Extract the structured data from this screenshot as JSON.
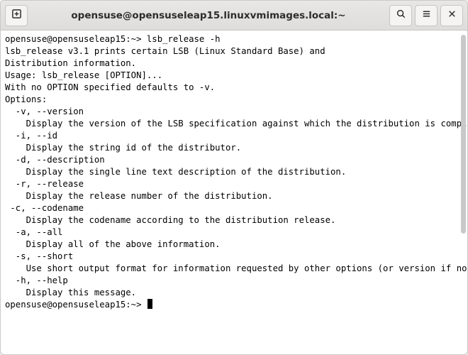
{
  "titlebar": {
    "title": "opensuse@opensuseleap15.linuxvmimages.local:~",
    "new_tab_icon": "new-tab-icon",
    "search_icon": "search-icon",
    "menu_icon": "hamburger-menu-icon",
    "close_icon": "close-icon"
  },
  "terminal": {
    "prompt1": "opensuse@opensuseleap15:~> ",
    "command1": "lsb_release -h",
    "output": [
      "lsb_release v3.1 prints certain LSB (Linux Standard Base) and",
      "Distribution information.",
      "",
      "Usage: lsb_release [OPTION]...",
      "With no OPTION specified defaults to -v.",
      "",
      "Options:",
      "  -v, --version",
      "    Display the version of the LSB specification against which the distribution is compliant.",
      "  -i, --id",
      "    Display the string id of the distributor.",
      "  -d, --description",
      "    Display the single line text description of the distribution.",
      "  -r, --release",
      "    Display the release number of the distribution.",
      " -c, --codename",
      "    Display the codename according to the distribution release.",
      "  -a, --all",
      "    Display all of the above information.",
      "  -s, --short",
      "    Use short output format for information requested by other options (or version if none).",
      "  -h, --help",
      "    Display this message."
    ],
    "prompt2": "opensuse@opensuseleap15:~> "
  }
}
